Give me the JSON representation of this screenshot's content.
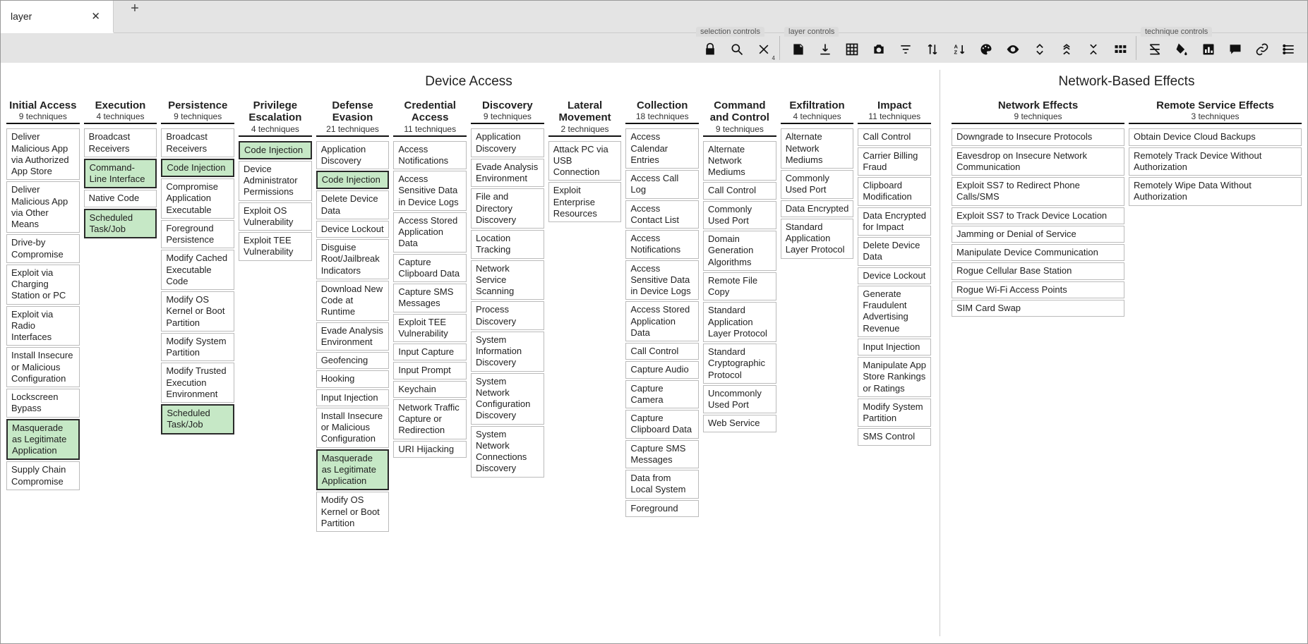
{
  "tab": {
    "name": "layer"
  },
  "toolbar": {
    "selection_label": "selection controls",
    "layer_label": "layer controls",
    "technique_label": "technique controls",
    "deselect_sub": "4"
  },
  "domains": [
    {
      "title": "Device Access",
      "cls": "device",
      "tactics": [
        {
          "name": "Initial Access",
          "count": "9 techniques",
          "techs": [
            {
              "t": "Deliver Malicious App via Authorized App Store"
            },
            {
              "t": "Deliver Malicious App via Other Means"
            },
            {
              "t": "Drive-by Compromise"
            },
            {
              "t": "Exploit via Charging Station or PC"
            },
            {
              "t": "Exploit via Radio Interfaces"
            },
            {
              "t": "Install Insecure or Malicious Configuration"
            },
            {
              "t": "Lockscreen Bypass"
            },
            {
              "t": "Masquerade as Legitimate Application",
              "hi": true
            },
            {
              "t": "Supply Chain Compromise"
            }
          ]
        },
        {
          "name": "Execution",
          "count": "4 techniques",
          "techs": [
            {
              "t": "Broadcast Receivers"
            },
            {
              "t": "Command-Line Interface",
              "hi": true
            },
            {
              "t": "Native Code"
            },
            {
              "t": "Scheduled Task/Job",
              "hi": true
            }
          ]
        },
        {
          "name": "Persistence",
          "count": "9 techniques",
          "techs": [
            {
              "t": "Broadcast Receivers"
            },
            {
              "t": "Code Injection",
              "hi": true
            },
            {
              "t": "Compromise Application Executable"
            },
            {
              "t": "Foreground Persistence"
            },
            {
              "t": "Modify Cached Executable Code"
            },
            {
              "t": "Modify OS Kernel or Boot Partition"
            },
            {
              "t": "Modify System Partition"
            },
            {
              "t": "Modify Trusted Execution Environment"
            },
            {
              "t": "Scheduled Task/Job",
              "hi": true
            }
          ]
        },
        {
          "name": "Privilege Escalation",
          "count": "4 techniques",
          "techs": [
            {
              "t": "Code Injection",
              "hi": true
            },
            {
              "t": "Device Administrator Permissions"
            },
            {
              "t": "Exploit OS Vulnerability"
            },
            {
              "t": "Exploit TEE Vulnerability"
            }
          ]
        },
        {
          "name": "Defense Evasion",
          "count": "21 techniques",
          "techs": [
            {
              "t": "Application Discovery"
            },
            {
              "t": "Code Injection",
              "hi": true
            },
            {
              "t": "Delete Device Data"
            },
            {
              "t": "Device Lockout"
            },
            {
              "t": "Disguise Root/Jailbreak Indicators"
            },
            {
              "t": "Download New Code at Runtime"
            },
            {
              "t": "Evade Analysis Environment"
            },
            {
              "t": "Geofencing"
            },
            {
              "t": "Hooking"
            },
            {
              "t": "Input Injection"
            },
            {
              "t": "Install Insecure or Malicious Configuration"
            },
            {
              "t": "Masquerade as Legitimate Application",
              "hi": true
            },
            {
              "t": "Modify OS Kernel or Boot Partition"
            }
          ]
        },
        {
          "name": "Credential Access",
          "count": "11 techniques",
          "techs": [
            {
              "t": "Access Notifications"
            },
            {
              "t": "Access Sensitive Data in Device Logs"
            },
            {
              "t": "Access Stored Application Data"
            },
            {
              "t": "Capture Clipboard Data"
            },
            {
              "t": "Capture SMS Messages"
            },
            {
              "t": "Exploit TEE Vulnerability"
            },
            {
              "t": "Input Capture"
            },
            {
              "t": "Input Prompt"
            },
            {
              "t": "Keychain"
            },
            {
              "t": "Network Traffic Capture or Redirection"
            },
            {
              "t": "URI Hijacking"
            }
          ]
        },
        {
          "name": "Discovery",
          "count": "9 techniques",
          "techs": [
            {
              "t": "Application Discovery"
            },
            {
              "t": "Evade Analysis Environment"
            },
            {
              "t": "File and Directory Discovery"
            },
            {
              "t": "Location Tracking"
            },
            {
              "t": "Network Service Scanning"
            },
            {
              "t": "Process Discovery"
            },
            {
              "t": "System Information Discovery"
            },
            {
              "t": "System Network Configuration Discovery"
            },
            {
              "t": "System Network Connections Discovery"
            }
          ]
        },
        {
          "name": "Lateral Movement",
          "count": "2 techniques",
          "techs": [
            {
              "t": "Attack PC via USB Connection"
            },
            {
              "t": "Exploit Enterprise Resources"
            }
          ]
        },
        {
          "name": "Collection",
          "count": "18 techniques",
          "techs": [
            {
              "t": "Access Calendar Entries"
            },
            {
              "t": "Access Call Log"
            },
            {
              "t": "Access Contact List"
            },
            {
              "t": "Access Notifications"
            },
            {
              "t": "Access Sensitive Data in Device Logs"
            },
            {
              "t": "Access Stored Application Data"
            },
            {
              "t": "Call Control"
            },
            {
              "t": "Capture Audio"
            },
            {
              "t": "Capture Camera"
            },
            {
              "t": "Capture Clipboard Data"
            },
            {
              "t": "Capture SMS Messages"
            },
            {
              "t": "Data from Local System"
            },
            {
              "t": "Foreground"
            }
          ]
        },
        {
          "name": "Command and Control",
          "count": "9 techniques",
          "techs": [
            {
              "t": "Alternate Network Mediums"
            },
            {
              "t": "Call Control"
            },
            {
              "t": "Commonly Used Port"
            },
            {
              "t": "Domain Generation Algorithms"
            },
            {
              "t": "Remote File Copy"
            },
            {
              "t": "Standard Application Layer Protocol"
            },
            {
              "t": "Standard Cryptographic Protocol"
            },
            {
              "t": "Uncommonly Used Port"
            },
            {
              "t": "Web Service"
            }
          ]
        },
        {
          "name": "Exfiltration",
          "count": "4 techniques",
          "techs": [
            {
              "t": "Alternate Network Mediums"
            },
            {
              "t": "Commonly Used Port"
            },
            {
              "t": "Data Encrypted"
            },
            {
              "t": "Standard Application Layer Protocol"
            }
          ]
        },
        {
          "name": "Impact",
          "count": "11 techniques",
          "techs": [
            {
              "t": "Call Control"
            },
            {
              "t": "Carrier Billing Fraud"
            },
            {
              "t": "Clipboard Modification"
            },
            {
              "t": "Data Encrypted for Impact"
            },
            {
              "t": "Delete Device Data"
            },
            {
              "t": "Device Lockout"
            },
            {
              "t": "Generate Fraudulent Advertising Revenue"
            },
            {
              "t": "Input Injection"
            },
            {
              "t": "Manipulate App Store Rankings or Ratings"
            },
            {
              "t": "Modify System Partition"
            },
            {
              "t": "SMS Control"
            }
          ]
        }
      ]
    },
    {
      "title": "Network-Based Effects",
      "cls": "network",
      "tactics": [
        {
          "name": "Network Effects",
          "count": "9 techniques",
          "techs": [
            {
              "t": "Downgrade to Insecure Protocols"
            },
            {
              "t": "Eavesdrop on Insecure Network Communication"
            },
            {
              "t": "Exploit SS7 to Redirect Phone Calls/SMS"
            },
            {
              "t": "Exploit SS7 to Track Device Location"
            },
            {
              "t": "Jamming or Denial of Service"
            },
            {
              "t": "Manipulate Device Communication"
            },
            {
              "t": "Rogue Cellular Base Station"
            },
            {
              "t": "Rogue Wi-Fi Access Points"
            },
            {
              "t": "SIM Card Swap"
            }
          ]
        },
        {
          "name": "Remote Service Effects",
          "count": "3 techniques",
          "techs": [
            {
              "t": "Obtain Device Cloud Backups"
            },
            {
              "t": "Remotely Track Device Without Authorization"
            },
            {
              "t": "Remotely Wipe Data Without Authorization"
            }
          ]
        }
      ]
    }
  ]
}
